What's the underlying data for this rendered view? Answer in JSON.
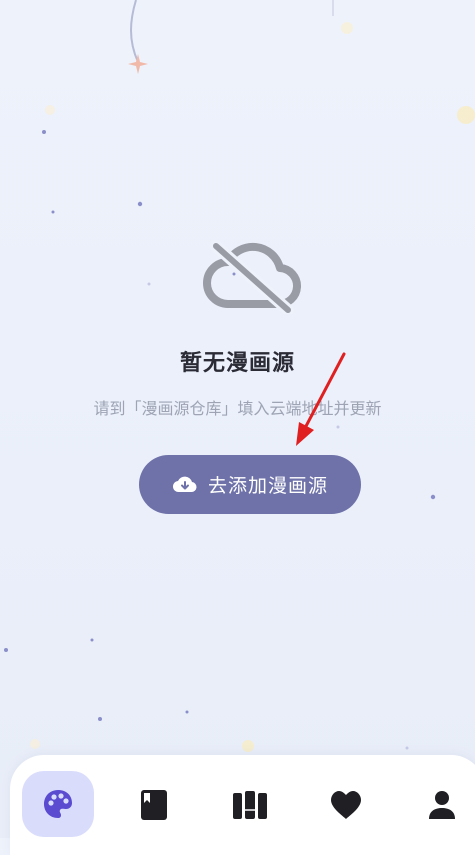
{
  "empty_state": {
    "icon": "cloud-off-icon",
    "title": "暂无漫画源",
    "subtitle": "请到「漫画源仓库」填入云端地址并更新"
  },
  "add_button": {
    "icon": "cloud-download-icon",
    "label": "去添加漫画源"
  },
  "bottom_nav": {
    "items": [
      {
        "icon": "palette-icon",
        "active": true
      },
      {
        "icon": "book-icon",
        "active": false
      },
      {
        "icon": "library-icon",
        "active": false
      },
      {
        "icon": "heart-icon",
        "active": false
      },
      {
        "icon": "person-icon",
        "active": false
      }
    ]
  },
  "colors": {
    "background": "#eef2fb",
    "accent": "#6e72a9",
    "active_nav": "#d9dcfb",
    "active_icon": "#5a4bd1",
    "arrow": "#e02020"
  }
}
